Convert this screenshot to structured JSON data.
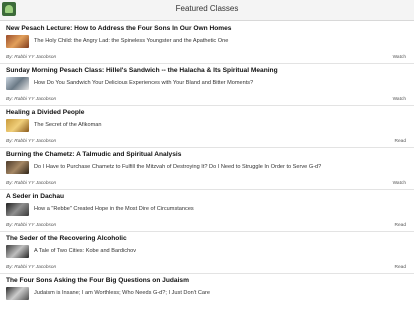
{
  "header": {
    "title": "Featured Classes",
    "app_icon": "tree-logo-icon"
  },
  "classes": [
    {
      "title": "New Pesach Lecture: How to Address the Four Sons In Our Own Homes",
      "subtitle": "The Holy Child: the Angry Lad: the Spineless Youngster and the Apathetic One",
      "author": "By: Rabbi YY Jacobson",
      "action": "Watch"
    },
    {
      "title": "Sunday Morning Pesach Class: Hillel's Sandwich -- the Halacha & Its Spiritual Meaning",
      "subtitle": "How Do You Sandwich Your Delicious Experiences with Your Bland and Bitter Moments?",
      "author": "By: Rabbi YY Jacobson",
      "action": "Watch"
    },
    {
      "title": "Healing a Divided People",
      "subtitle": "The Secret of the Afikoman",
      "author": "By: Rabbi YY Jacobson",
      "action": "Read"
    },
    {
      "title": "Burning the Chametz: A Talmudic and Spiritual Analysis",
      "subtitle": "Do I Have to Purchase Chametz to Fulfill the Mitzvah of Destroying It? Do I Need to Struggle In Order to Serve G-d?",
      "author": "By: Rabbi YY Jacobson",
      "action": "Watch"
    },
    {
      "title": "A Seder in Dachau",
      "subtitle": "How a \"Rebbe\" Created Hope in the Most Dire of Circumstances",
      "author": "By: Rabbi YY Jacobson",
      "action": "Read"
    },
    {
      "title": "The Seder of the Recovering Alcoholic",
      "subtitle": "A Tale of Two Cities: Kobe and Bardichov",
      "author": "By: Rabbi YY Jacobson",
      "action": "Read"
    },
    {
      "title": "The Four Sons Asking the Four Big Questions on Judaism",
      "subtitle": "Judaism is Insane; I am Worthless; Who Needs G-d?; I Just Don't Care",
      "author": "",
      "action": ""
    }
  ]
}
